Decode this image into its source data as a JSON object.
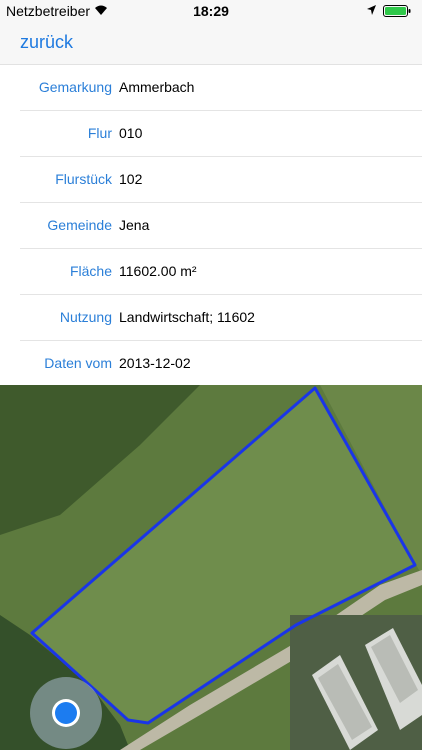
{
  "status_bar": {
    "carrier": "Netzbetreiber",
    "time": "18:29"
  },
  "nav": {
    "back_label": "zurück"
  },
  "rows": [
    {
      "label": "Gemarkung",
      "value": "Ammerbach"
    },
    {
      "label": "Flur",
      "value": "010"
    },
    {
      "label": "Flurstück",
      "value": "102"
    },
    {
      "label": "Gemeinde",
      "value": "Jena"
    },
    {
      "label": "Fläche",
      "value": "11602.00 m²"
    },
    {
      "label": "Nutzung",
      "value": "Landwirtschaft; 11602"
    },
    {
      "label": "Daten vom",
      "value": "2013-12-02"
    }
  ],
  "map": {
    "parcel_outline_color": "#1a35e8",
    "location_color": "#1c7cf0"
  }
}
